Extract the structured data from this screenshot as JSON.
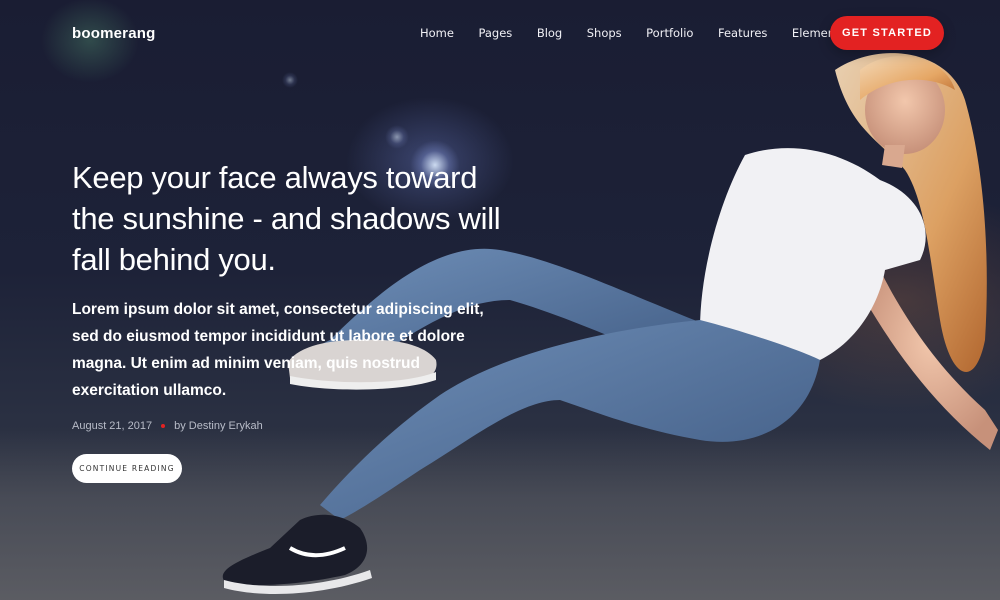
{
  "brand": {
    "logo_text": "boomerang"
  },
  "nav": {
    "items": [
      {
        "label": "Home"
      },
      {
        "label": "Pages"
      },
      {
        "label": "Blog"
      },
      {
        "label": "Shops"
      },
      {
        "label": "Portfolio"
      },
      {
        "label": "Features"
      },
      {
        "label": "Elements"
      }
    ],
    "cta_label": "GET STARTED"
  },
  "hero": {
    "headline": "Keep your face always toward the sunshine - and shadows will fall behind you.",
    "body": "Lorem ipsum dolor sit amet, consectetur adipiscing elit, sed do eiusmod tempor incididunt ut labore et dolore magna. Ut enim ad minim veniam, quis nostrud exercitation ullamco.",
    "date": "August 21, 2017",
    "author": "by Destiny Erykah",
    "button_label": "CONTINUE READING"
  },
  "colors": {
    "accent": "#e32222",
    "background": "#1a1d33"
  }
}
